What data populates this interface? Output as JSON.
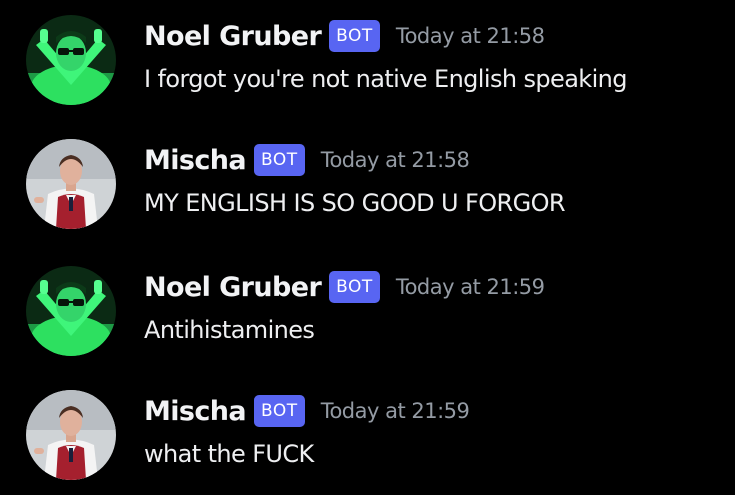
{
  "messages": [
    {
      "author": "Noel Gruber",
      "tag": "BOT",
      "timestamp": "Today at 21:58",
      "content": "I forgot you're not native English speaking",
      "avatar_icon": "avatar-noel-gruber-green-sunglasses-crossed-arms"
    },
    {
      "author": "Mischa",
      "tag": "BOT",
      "timestamp": "Today at 21:58",
      "content": "MY ENGLISH IS SO GOOD U FORGOR",
      "avatar_icon": "avatar-mischa-red-vest"
    },
    {
      "author": "Noel Gruber",
      "tag": "BOT",
      "timestamp": "Today at 21:59",
      "content": "Antihistamines",
      "avatar_icon": "avatar-noel-gruber-green-sunglasses-crossed-arms"
    },
    {
      "author": "Mischa",
      "tag": "BOT",
      "timestamp": "Today at 21:59",
      "content": "what the FUCK",
      "avatar_icon": "avatar-mischa-red-vest"
    }
  ],
  "colors": {
    "background": "#000000",
    "bot_tag": "#5865f2",
    "username": "#f2f3f5",
    "timestamp": "#949ba4",
    "noel_avatar_green": "#2de060",
    "mischa_vest": "#a5202e"
  }
}
